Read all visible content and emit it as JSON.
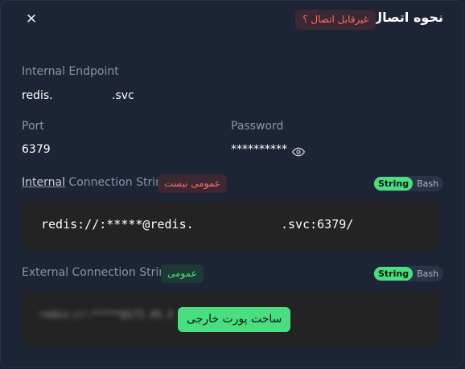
{
  "header": {
    "title": "نحوه اتصال",
    "status_badge": "غیرقابل اتصال ؟",
    "close_icon": "close-icon"
  },
  "internal_endpoint": {
    "label": "Internal Endpoint",
    "value_prefix": "redis.",
    "value_suffix": ".svc"
  },
  "port": {
    "label": "Port",
    "value": "6379"
  },
  "password": {
    "label": "Password",
    "value": "**********",
    "icon": "eye-icon"
  },
  "internal_connection": {
    "label_underlined": "Internal",
    "label_rest": " Connection String",
    "badge": "عمومی نیست",
    "toggle": [
      "String",
      "Bash"
    ],
    "active": "String",
    "code_prefix": "redis://:*****@redis.",
    "code_suffix": ".svc:6379/"
  },
  "external_connection": {
    "label": "External Connection String",
    "badge": "عمومی",
    "toggle": [
      "String",
      "Bash"
    ],
    "active": "String",
    "blurred_placeholder": "redis://:*****@172.45.2",
    "create_button": "ساخت پورت خارجی"
  },
  "colors": {
    "background": "#1d2436",
    "accent_green": "#4ade80",
    "danger": "#ff6b6b",
    "code_bg": "#232323"
  }
}
